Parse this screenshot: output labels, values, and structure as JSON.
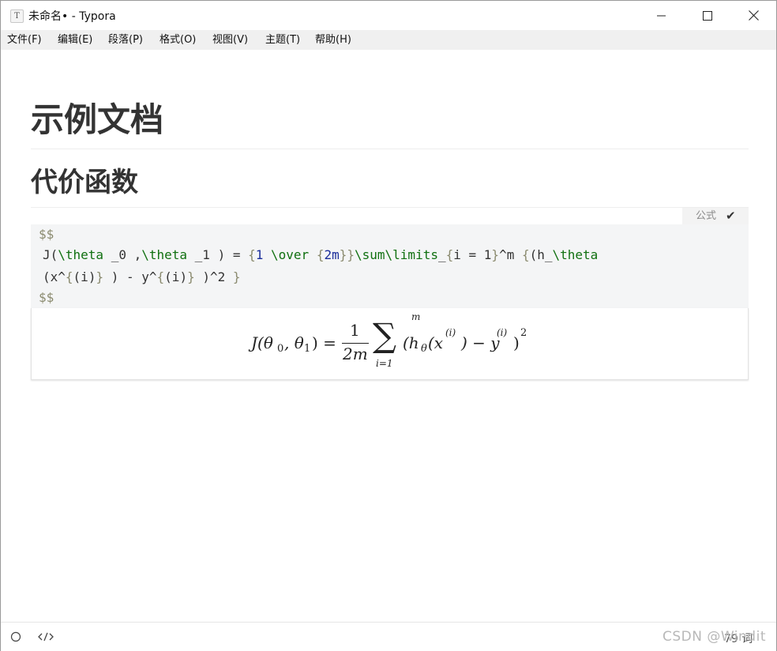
{
  "window": {
    "title": "未命名• - Typora",
    "app_icon_letter": "T"
  },
  "menu": {
    "items": [
      "文件(F)",
      "编辑(E)",
      "段落(P)",
      "格式(O)",
      "视图(V)",
      "主题(T)",
      "帮助(H)"
    ]
  },
  "document": {
    "h1": "示例文档",
    "h2": "代价函数",
    "math_block": {
      "tag_label": "公式",
      "tag_check": "✔",
      "source_open": "$$",
      "source_close": "$$",
      "source_line_1": "J(\\theta _0 ,\\theta _1 ) = {1 \\over {2m}}\\sum\\limits_{i = 1}^m {(h_\\theta",
      "source_line_2": "(x^{(i)} ) - y^{(i)} )^2 }",
      "rendered": {
        "lhs": "J(θ",
        "sub0": "0",
        "mid": ", θ",
        "sub1": "1",
        "rhs_eq": ") =",
        "numerator": "1",
        "denominator": "2m",
        "sum_symbol": "∑",
        "sum_upper": "m",
        "sum_lower": "i=1",
        "body_a": "(h",
        "h_sub": "θ",
        "body_b": "(x",
        "sup_i_1": "(i)",
        "body_c": ") − y",
        "sup_i_2": "(i)",
        "body_d": ")",
        "power": "2"
      }
    }
  },
  "status": {
    "word_count": "79 词",
    "watermark": "CSDN @Windit"
  }
}
